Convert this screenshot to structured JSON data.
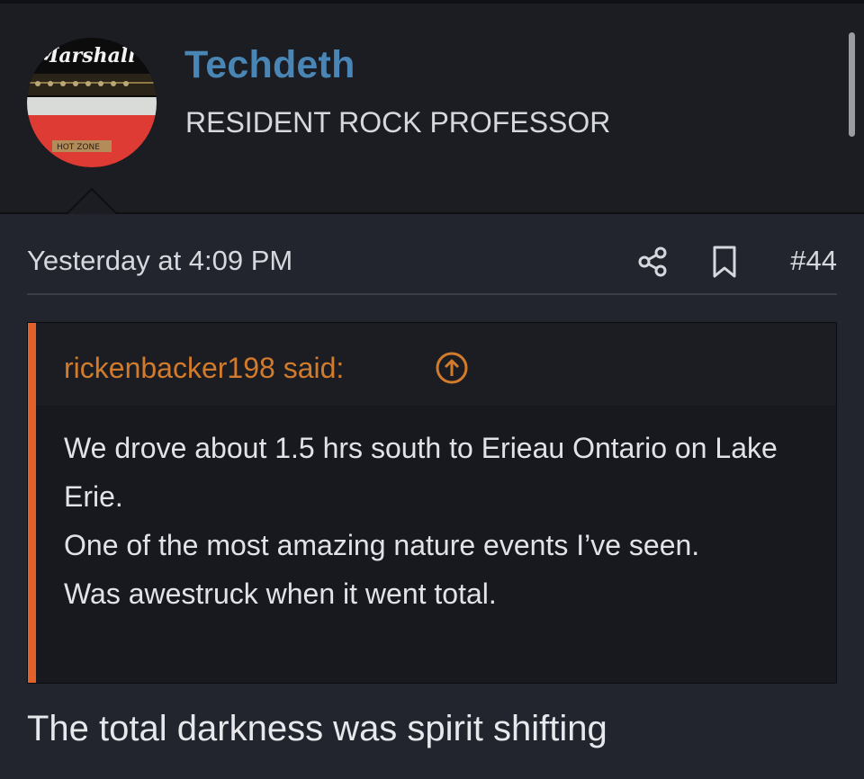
{
  "user": {
    "name": "Techdeth",
    "title": "RESIDENT ROCK PROFESSOR",
    "avatar": {
      "brand_text": "Marshall",
      "panel_text": "HOT ZONE"
    }
  },
  "post": {
    "date": "Yesterday at 4:09 PM",
    "number": "#44",
    "icons": {
      "share": "share-icon",
      "bookmark": "bookmark-icon"
    },
    "quote": {
      "author": "rickenbacker198 said:",
      "lines": [
        "We drove about 1.5 hrs south to Erieau Ontario on Lake Erie.",
        "One of the most amazing nature events I’ve seen.",
        "Was awestruck when it went total."
      ]
    },
    "text": "The total darkness was spirit shifting"
  },
  "colors": {
    "username": "#4a86b5",
    "quote_accent": "#e2612b",
    "quote_author": "#d27b2c",
    "background": "#22252d"
  }
}
